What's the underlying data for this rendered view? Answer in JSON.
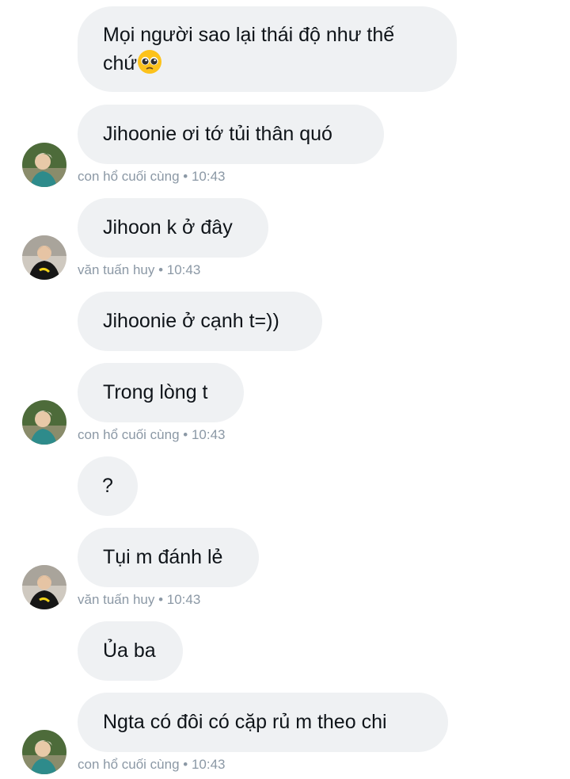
{
  "conversation": {
    "messages": [
      {
        "text": "Mọi người sao lại thái độ như thế chứ",
        "emoji": "pleading-face"
      },
      {
        "text": "Jihoonie ơi tớ tủi thân quó"
      },
      {
        "text": "Jihoon k ở đây"
      },
      {
        "text": "Jihoonie ở cạnh t=))"
      },
      {
        "text": "Trong lòng t"
      },
      {
        "text": "?"
      },
      {
        "text": "Tụi m đánh lẻ"
      },
      {
        "text": "Ủa ba"
      },
      {
        "text": "Ngta có đôi có cặp rủ m theo chi"
      }
    ],
    "meta": [
      {
        "sender": "con hổ cuối cùng",
        "time": "10:43"
      },
      {
        "sender": "văn tuấn huy",
        "time": "10:43"
      },
      {
        "sender": "con hổ cuối cùng",
        "time": "10:43"
      },
      {
        "sender": "văn tuấn huy",
        "time": "10:43"
      },
      {
        "sender": "con hổ cuối cùng",
        "time": "10:43"
      }
    ],
    "separator": " • "
  },
  "avatars": [
    {
      "icon": "user-avatar-green-shirt"
    },
    {
      "icon": "user-avatar-black-shirt"
    },
    {
      "icon": "user-avatar-green-shirt"
    },
    {
      "icon": "user-avatar-black-shirt"
    },
    {
      "icon": "user-avatar-green-shirt"
    }
  ],
  "colors": {
    "bubble": "#eff1f3",
    "text": "#0f1419",
    "meta": "#8b98a5"
  }
}
